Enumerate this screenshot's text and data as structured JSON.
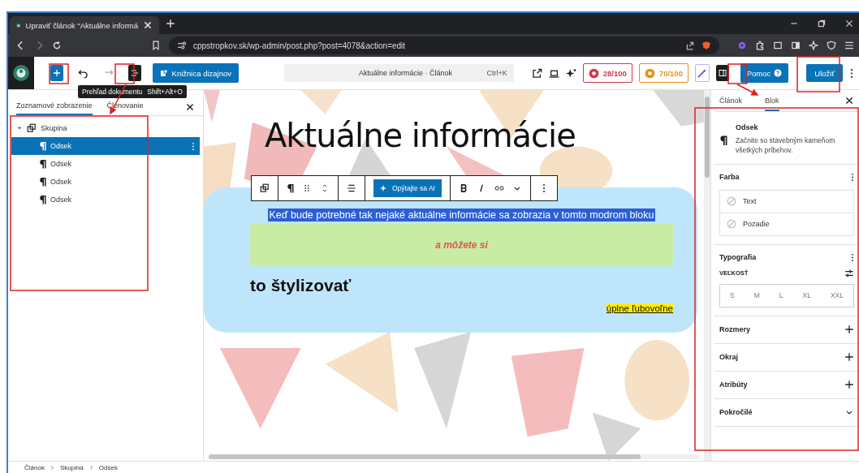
{
  "browser": {
    "tab_title": "Upraviť článok \"Aktuálne informá",
    "url": "cppstropkov.sk/wp-admin/post.php?post=4078&action=edit"
  },
  "toolbar": {
    "design_library": "Knižnica dizajnov",
    "tooltip": {
      "label": "Prehľad dokumentu",
      "shortcut": "Shift+Alt+O"
    },
    "command": {
      "title": "Aktuálne informácie · Článok",
      "shortcut": "Ctrl+K"
    },
    "scores": [
      {
        "value": "28/100",
        "color": "#d63649"
      },
      {
        "value": "70/100",
        "color": "#e8901a"
      }
    ],
    "help": "Pomoc",
    "save": "Uložiť"
  },
  "left_panel": {
    "tabs": [
      {
        "label": "Zoznamové zobrazenie",
        "selected": true
      },
      {
        "label": "Členovanie",
        "selected": false
      }
    ],
    "tree": [
      {
        "label": "Skupina",
        "expanded": true,
        "selected": false,
        "children": [
          {
            "label": "Odsek",
            "selected": true
          },
          {
            "label": "Odsek",
            "selected": false
          },
          {
            "label": "Odsek",
            "selected": false
          },
          {
            "label": "Odsek",
            "selected": false
          }
        ]
      }
    ]
  },
  "canvas": {
    "title": "Aktuálne informácie",
    "ai_button": "Opýtajte sa AI",
    "blocks": [
      {
        "kind": "selected",
        "text": "Keď bude potrebné tak nejaké aktuálne informácie sa zobrazia v tomto modrom bloku"
      },
      {
        "kind": "boxed",
        "text": "a môžete si"
      },
      {
        "kind": "heading",
        "text": "to štylizovať"
      },
      {
        "kind": "marked",
        "text": "úplne ľubovoľne"
      }
    ]
  },
  "right_panel": {
    "tabs": [
      {
        "label": "Článok",
        "selected": false
      },
      {
        "label": "Blok",
        "selected": true
      }
    ],
    "block": {
      "name": "Odsek",
      "description": "Začnite so stavebným kameňom všetkých príbehov."
    },
    "color": {
      "title": "Farba",
      "items": [
        "Text",
        "Pozadie"
      ]
    },
    "typography": {
      "title": "Typografia",
      "size_label": "VEĽKOSŤ",
      "sizes": [
        "S",
        "M",
        "L",
        "XL",
        "XXL"
      ]
    },
    "panels": [
      {
        "title": "Rozmery",
        "kind": "add"
      },
      {
        "title": "Okraj",
        "kind": "add"
      },
      {
        "title": "Atribúty",
        "kind": "add"
      },
      {
        "title": "Pokročilé",
        "kind": "expand"
      }
    ]
  },
  "breadcrumb": [
    "Článok",
    "Skupina",
    "Odsek"
  ]
}
